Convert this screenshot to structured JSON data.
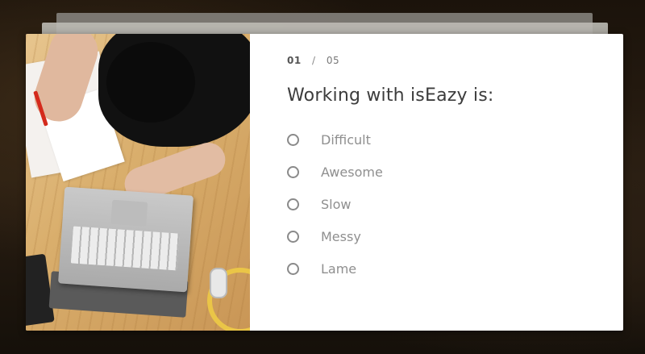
{
  "quiz": {
    "counter": {
      "current": "01",
      "separator": "/",
      "total": "05"
    },
    "question": "Working with isEazy is:",
    "options": [
      {
        "label": "Difficult",
        "selected": false
      },
      {
        "label": "Awesome",
        "selected": false
      },
      {
        "label": "Slow",
        "selected": false
      },
      {
        "label": "Messy",
        "selected": false
      },
      {
        "label": "Lame",
        "selected": false
      }
    ]
  },
  "colors": {
    "card_background": "#ffffff",
    "question_text": "#3c3c3c",
    "option_text": "#8f8f8f",
    "radio_border": "#8a8a8a",
    "backdrop": "#1b130b"
  },
  "icons": {
    "option_marker": "radio-unchecked-icon"
  }
}
